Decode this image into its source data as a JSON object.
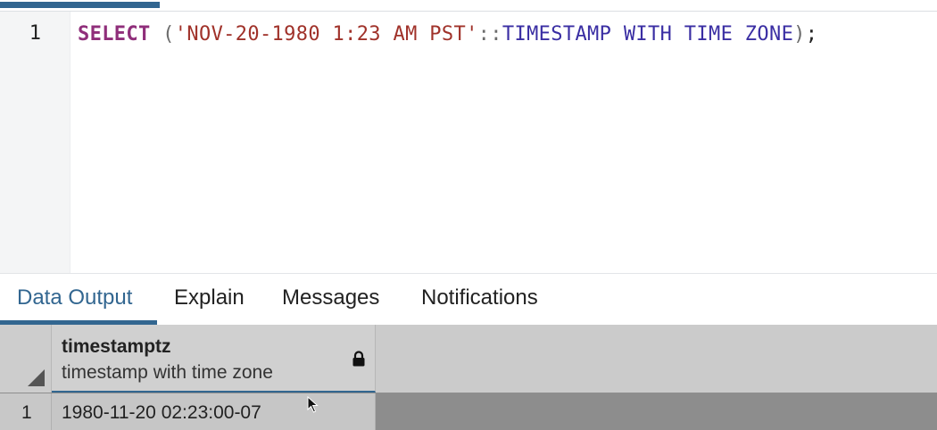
{
  "editor": {
    "line_number": "1",
    "tokens": {
      "keyword": "SELECT",
      "open_paren": " (",
      "string_literal": "'NOV-20-1980 1:23 AM PST'",
      "cast_operator": "::",
      "type_name": "TIMESTAMP WITH TIME ZONE",
      "close_paren": ")",
      "semicolon": ";"
    }
  },
  "result_tabs": [
    {
      "label": "Data Output",
      "active": true
    },
    {
      "label": "Explain",
      "active": false
    },
    {
      "label": "Messages",
      "active": false
    },
    {
      "label": "Notifications",
      "active": false
    }
  ],
  "grid": {
    "columns": [
      {
        "name": "timestamptz",
        "type": "timestamp with time zone",
        "read_only_icon": "lock-icon"
      }
    ],
    "rows": [
      {
        "row_number": "1",
        "values": [
          "1980-11-20 02:23:00-07"
        ]
      }
    ]
  },
  "colors": {
    "accent": "#326690",
    "keyword": "#8f2e7a",
    "string": "#a0322a",
    "type": "#3a2ea3"
  }
}
